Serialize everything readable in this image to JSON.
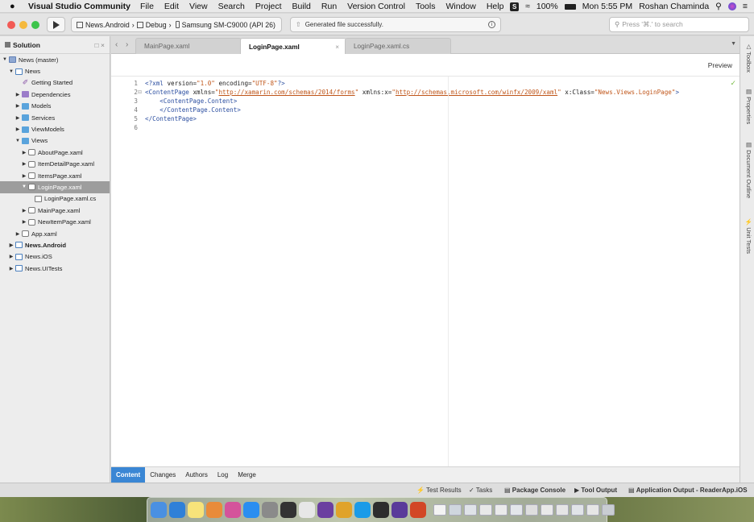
{
  "menubar": {
    "app_name": "Visual Studio Community",
    "items": [
      "File",
      "Edit",
      "View",
      "Search",
      "Project",
      "Build",
      "Run",
      "Version Control",
      "Tools",
      "Window",
      "Help"
    ],
    "battery": "100%",
    "time": "Mon 5:55 PM",
    "user": "Roshan Chaminda"
  },
  "toolbar": {
    "crumb_project": "News.Android",
    "crumb_config": "Debug",
    "crumb_device": "Samsung SM-C9000 (API 26)",
    "status_text": "Generated file successfully.",
    "search_placeholder": "Press '⌘.' to search"
  },
  "solution": {
    "title": "Solution",
    "tree": [
      {
        "label": "News (master)",
        "indent": 0,
        "expanded": true,
        "icon": "sol"
      },
      {
        "label": "News",
        "indent": 1,
        "expanded": true,
        "icon": "proj"
      },
      {
        "label": "Getting Started",
        "indent": 2,
        "icon": "gs"
      },
      {
        "label": "Dependencies",
        "indent": 2,
        "expanded": false,
        "icon": "pfolder"
      },
      {
        "label": "Models",
        "indent": 2,
        "expanded": false,
        "icon": "folder"
      },
      {
        "label": "Services",
        "indent": 2,
        "expanded": false,
        "icon": "folder"
      },
      {
        "label": "ViewModels",
        "indent": 2,
        "expanded": false,
        "icon": "folder"
      },
      {
        "label": "Views",
        "indent": 2,
        "expanded": true,
        "icon": "folder"
      },
      {
        "label": "AboutPage.xaml",
        "indent": 3,
        "expanded": false,
        "icon": "xaml"
      },
      {
        "label": "ItemDetailPage.xaml",
        "indent": 3,
        "expanded": false,
        "icon": "xaml"
      },
      {
        "label": "ItemsPage.xaml",
        "indent": 3,
        "expanded": false,
        "icon": "xaml"
      },
      {
        "label": "LoginPage.xaml",
        "indent": 3,
        "expanded": true,
        "icon": "xaml",
        "selected": true
      },
      {
        "label": "LoginPage.xaml.cs",
        "indent": 4,
        "icon": "cs"
      },
      {
        "label": "MainPage.xaml",
        "indent": 3,
        "expanded": false,
        "icon": "xaml"
      },
      {
        "label": "NewItemPage.xaml",
        "indent": 3,
        "expanded": false,
        "icon": "xaml"
      },
      {
        "label": "App.xaml",
        "indent": 2,
        "expanded": false,
        "icon": "xaml"
      },
      {
        "label": "News.Android",
        "indent": 1,
        "expanded": false,
        "icon": "proj",
        "bold": true
      },
      {
        "label": "News.iOS",
        "indent": 1,
        "expanded": false,
        "icon": "proj"
      },
      {
        "label": "News.UITests",
        "indent": 1,
        "expanded": false,
        "icon": "proj"
      }
    ]
  },
  "tabs": [
    {
      "label": "MainPage.xaml",
      "active": false
    },
    {
      "label": "LoginPage.xaml",
      "active": true
    },
    {
      "label": "LoginPage.xaml.cs",
      "active": false
    }
  ],
  "editor": {
    "preview_label": "Preview",
    "line_numbers": [
      "1",
      "2",
      "3",
      "4",
      "5",
      "6"
    ],
    "lines": [
      [
        {
          "t": "tg",
          "v": "<?xml "
        },
        {
          "t": "tx",
          "v": "version="
        },
        {
          "t": "st",
          "v": "\"1.0\""
        },
        {
          "t": "tx",
          "v": " encoding="
        },
        {
          "t": "st",
          "v": "\"UTF-8\""
        },
        {
          "t": "tg",
          "v": "?>"
        }
      ],
      [
        {
          "t": "tg",
          "v": "<ContentPage "
        },
        {
          "t": "tx",
          "v": "xmlns="
        },
        {
          "t": "st",
          "v": "\""
        },
        {
          "t": "ul",
          "v": "http://xamarin.com/schemas/2014/forms"
        },
        {
          "t": "st",
          "v": "\""
        },
        {
          "t": "tx",
          "v": " xmlns:x="
        },
        {
          "t": "st",
          "v": "\""
        },
        {
          "t": "ul",
          "v": "http://schemas.microsoft.com/winfx/2009/xaml"
        },
        {
          "t": "st",
          "v": "\""
        },
        {
          "t": "tx",
          "v": " x:Class="
        },
        {
          "t": "st",
          "v": "\"News.Views.LoginPage\""
        },
        {
          "t": "tg",
          "v": ">"
        }
      ],
      [
        {
          "t": "tg",
          "v": "    <ContentPage.Content>"
        }
      ],
      [
        {
          "t": "tg",
          "v": "    </ContentPage.Content>"
        }
      ],
      [
        {
          "t": "tg",
          "v": "</ContentPage>"
        }
      ],
      []
    ]
  },
  "right_pane": [
    "Toolbox",
    "Properties",
    "Document Outline",
    "Unit Tests"
  ],
  "bottom_tabs": [
    {
      "label": "Content",
      "active": true
    },
    {
      "label": "Changes"
    },
    {
      "label": "Authors"
    },
    {
      "label": "Log"
    },
    {
      "label": "Merge"
    }
  ],
  "statusbar": {
    "test_results": "Test Results",
    "tasks": "Tasks",
    "package_console": "Package Console",
    "tool_output": "Tool Output",
    "app_output": "Application Output - ReaderApp.iOS"
  },
  "colors": {
    "accent": "#3a86d4",
    "traffic_red": "#f25a55",
    "traffic_yellow": "#f5b93c",
    "traffic_green": "#3cc44a",
    "xml_tag": "#2b4ea0",
    "xml_string": "#c0561a"
  },
  "dock_icons": [
    {
      "name": "finder-icon",
      "color": "#4a90e2"
    },
    {
      "name": "safari-icon",
      "color": "#2f80d8"
    },
    {
      "name": "notes-icon",
      "color": "#f7e37a"
    },
    {
      "name": "photos-icon",
      "color": "#e98b3a"
    },
    {
      "name": "itunes-icon",
      "color": "#d4539b"
    },
    {
      "name": "app-store-icon",
      "color": "#2a8ef0"
    },
    {
      "name": "system-prefs-icon",
      "color": "#8a8a8a"
    },
    {
      "name": "skype-icon",
      "color": "#333333"
    },
    {
      "name": "hex-app-icon",
      "color": "#e7e7e7"
    },
    {
      "name": "visual-studio-icon",
      "color": "#6b3fa0"
    },
    {
      "name": "chrome-icon",
      "color": "#e0a32a"
    },
    {
      "name": "skype-blue-icon",
      "color": "#1a9be8"
    },
    {
      "name": "terminal-icon",
      "color": "#2d2d2d"
    },
    {
      "name": "vs-code-icon",
      "color": "#5a3a9a"
    },
    {
      "name": "powerpoint-icon",
      "color": "#d24726"
    },
    {
      "name": "document-icon",
      "color": "#f3f3f3"
    },
    {
      "name": "preview-icon",
      "color": "#cfd6de"
    },
    {
      "name": "window-thumb-1-icon",
      "color": "#dfe3e8"
    },
    {
      "name": "window-thumb-2-icon",
      "color": "#e8e8e8"
    },
    {
      "name": "window-thumb-3-icon",
      "color": "#eaeaea"
    },
    {
      "name": "window-thumb-4-icon",
      "color": "#e3e6ea"
    },
    {
      "name": "window-thumb-5-icon",
      "color": "#dedede"
    },
    {
      "name": "window-thumb-6-icon",
      "color": "#e9e9e9"
    },
    {
      "name": "window-thumb-7-icon",
      "color": "#e5e5e5"
    },
    {
      "name": "window-thumb-8-icon",
      "color": "#e1e4e8"
    },
    {
      "name": "window-thumb-9-icon",
      "color": "#e6e6e6"
    },
    {
      "name": "trash-icon",
      "color": "#c9cdd2"
    }
  ]
}
